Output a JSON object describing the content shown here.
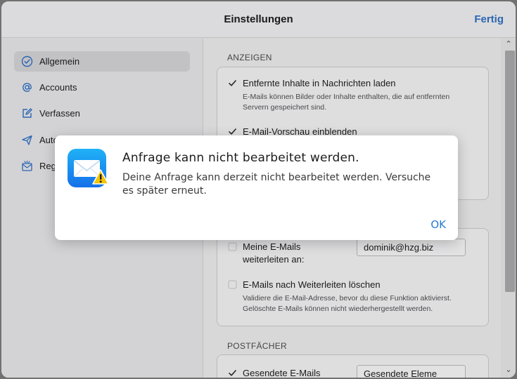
{
  "header": {
    "title": "Einstellungen",
    "done_label": "Fertig"
  },
  "sidebar": {
    "items": [
      {
        "label": "Allgemein",
        "icon": "checkmark-circle-icon",
        "active": true
      },
      {
        "label": "Accounts",
        "icon": "at-sign-icon"
      },
      {
        "label": "Verfassen",
        "icon": "compose-icon"
      },
      {
        "label": "Auto",
        "icon": "paper-plane-icon"
      },
      {
        "label": "Reg",
        "icon": "rules-envelope-icon"
      }
    ]
  },
  "content": {
    "section_display": "ANZEIGEN",
    "remote_content_label": "Entfernte Inhalte in Nachrichten laden",
    "remote_content_checked": true,
    "remote_content_desc": "E-Mails können Bilder oder Inhalte enthalten, die auf entfernten Servern gespeichert sind.",
    "preview_label": "E-Mail-Vorschau einblenden",
    "preview_checked": true,
    "forward_label": "Meine E-Mails weiterleiten an:",
    "forward_checked": false,
    "forward_email": "dominik@hzg.biz",
    "delete_after_forward_label": "E-Mails nach Weiterleiten löschen",
    "delete_after_forward_checked": false,
    "delete_desc": "Validiere die E-Mail-Adresse, bevor du diese Funktion aktivierst. Gelöschte E-Mails können nicht wiederhergestellt werden.",
    "section_mailboxes": "POSTFÄCHER",
    "sent_label": "Gesendete E-Mails",
    "sent_checked": true,
    "sent_value": "Gesendete Eleme"
  },
  "dialog": {
    "icon": "mail-warning-icon",
    "title": "Anfrage kann nicht bearbeitet werden.",
    "message": "Deine Anfrage kann derzeit nicht bearbeitet werden. Versuche es später erneut.",
    "ok_label": "OK"
  },
  "colors": {
    "accent": "#2f6ec0",
    "dialog_button": "#2a7ad0",
    "warning": "#f5c400"
  }
}
